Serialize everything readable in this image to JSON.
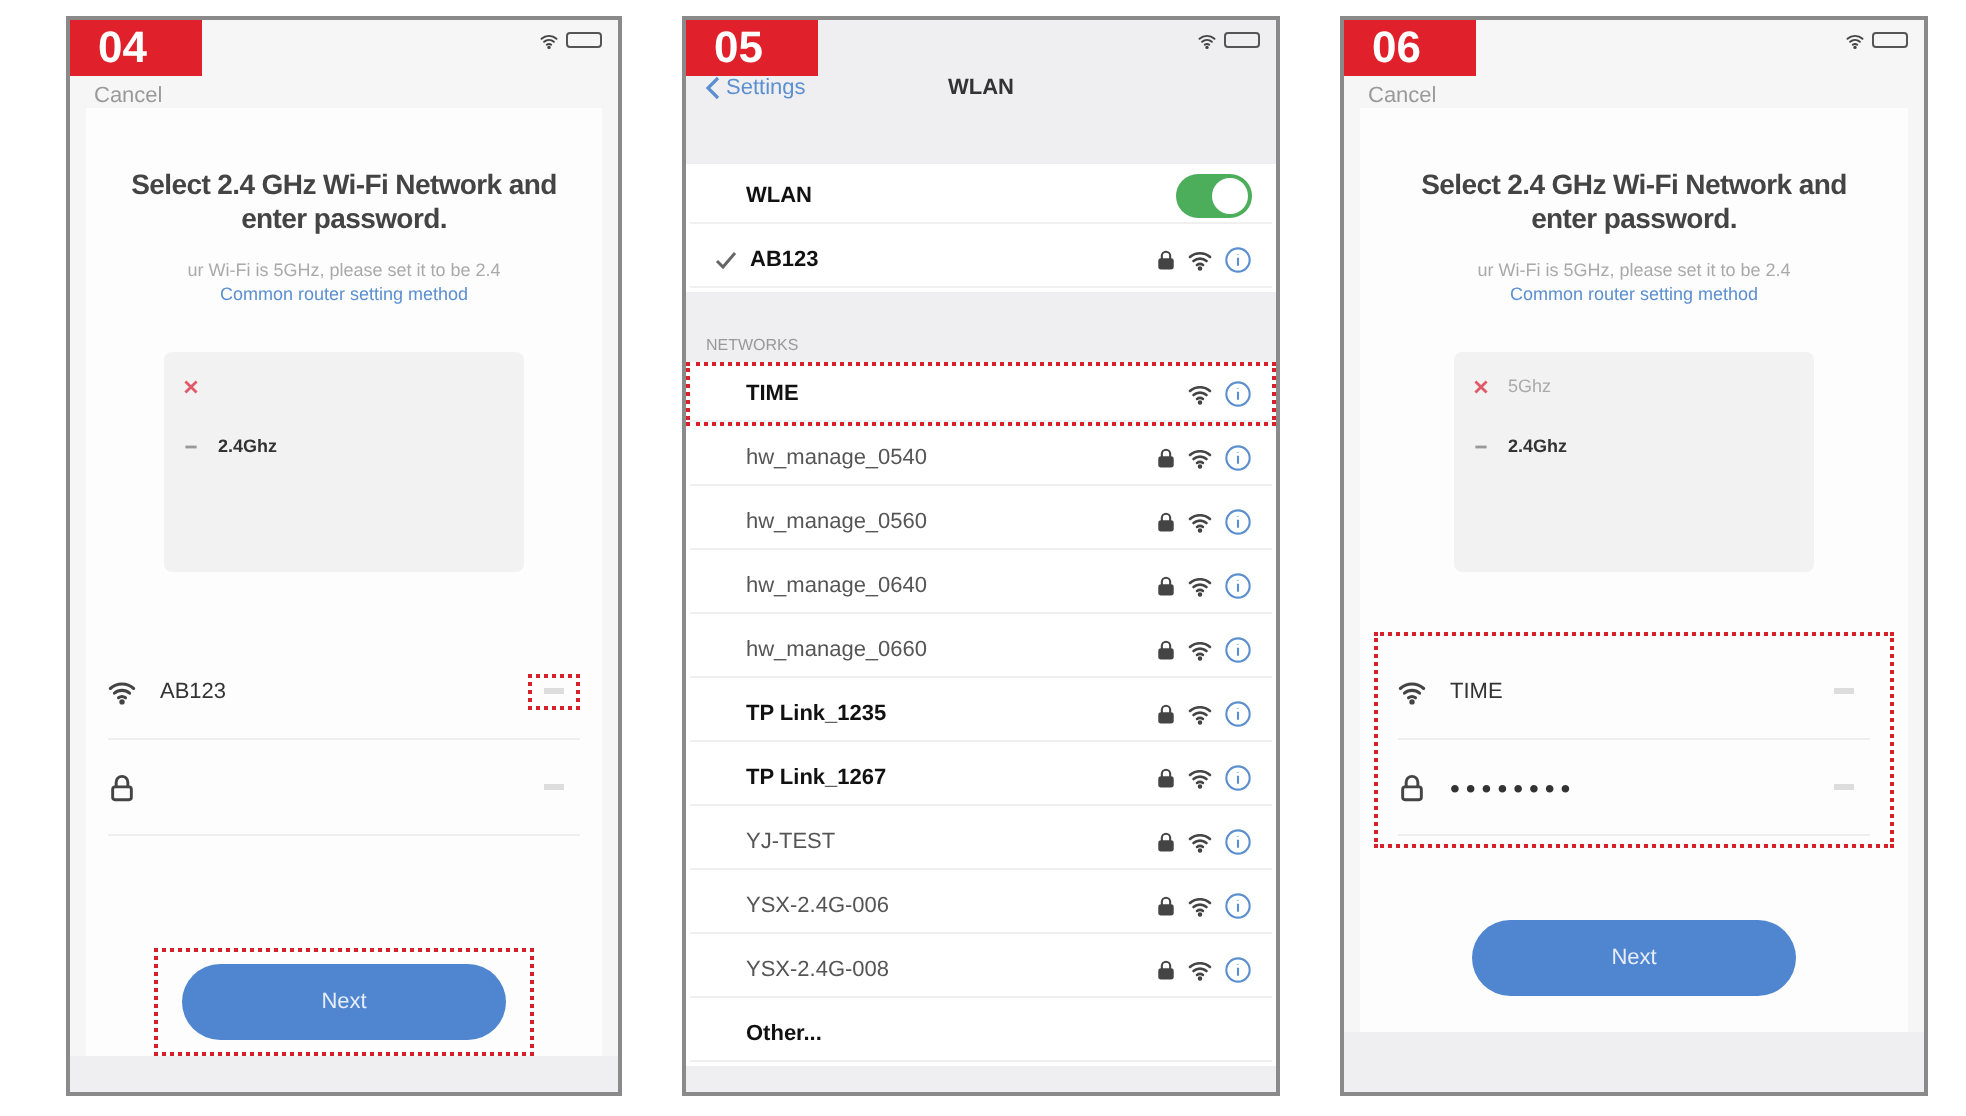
{
  "panels": [
    {
      "kind": "app",
      "badge": "04",
      "cancel": "Cancel",
      "title": "Select 2.4 GHz Wi-Fi Network and enter password.",
      "note": "ur Wi-Fi is 5GHz, please set it to be 2.4",
      "link": "Common router setting method",
      "bands": [
        {
          "rejected": true
        },
        {
          "label": "2.4Ghz",
          "rejected": false
        }
      ],
      "ssid": "AB123",
      "hint_highlighted": true,
      "fields_highlighted": false,
      "button": "Next",
      "button_highlighted": true
    },
    {
      "kind": "settings",
      "badge": "05",
      "back": "Settings",
      "title": "WLAN",
      "wlan_label": "WLAN",
      "wlan_on": true,
      "connected": {
        "name": "AB123",
        "checked": true,
        "locked": true
      },
      "section": "NETWORKS",
      "networks": [
        {
          "name": "TIME",
          "locked": false,
          "strong": true,
          "highlighted": true
        },
        {
          "name": "hw_manage_0540",
          "locked": true,
          "strong": false,
          "highlighted": false
        },
        {
          "name": "hw_manage_0560",
          "locked": true,
          "strong": false,
          "highlighted": false
        },
        {
          "name": "hw_manage_0640",
          "locked": true,
          "strong": false,
          "highlighted": false
        },
        {
          "name": "hw_manage_0660",
          "locked": true,
          "strong": false,
          "highlighted": false
        },
        {
          "name": "TP Link_1235",
          "locked": true,
          "strong": true,
          "highlighted": false
        },
        {
          "name": "TP Link_1267",
          "locked": true,
          "strong": true,
          "highlighted": false
        },
        {
          "name": "YJ-TEST",
          "locked": true,
          "strong": false,
          "highlighted": false
        },
        {
          "name": "YSX-2.4G-006",
          "locked": true,
          "strong": false,
          "highlighted": false
        },
        {
          "name": "YSX-2.4G-008",
          "locked": true,
          "strong": false,
          "highlighted": false
        }
      ],
      "other": "Other..."
    },
    {
      "kind": "app",
      "badge": "06",
      "cancel": "Cancel",
      "title": "Select 2.4 GHz Wi-Fi Network and enter password.",
      "note": "ur Wi-Fi is 5GHz, please set it to be 2.4",
      "link": "Common router setting method",
      "bands": [
        {
          "label": "5Ghz",
          "rejected": true
        },
        {
          "label": "2.4Ghz",
          "rejected": false
        }
      ],
      "ssid": "TIME",
      "password": "••••••••",
      "hint_highlighted": false,
      "fields_highlighted": true,
      "button": "Next",
      "button_highlighted": false
    }
  ]
}
